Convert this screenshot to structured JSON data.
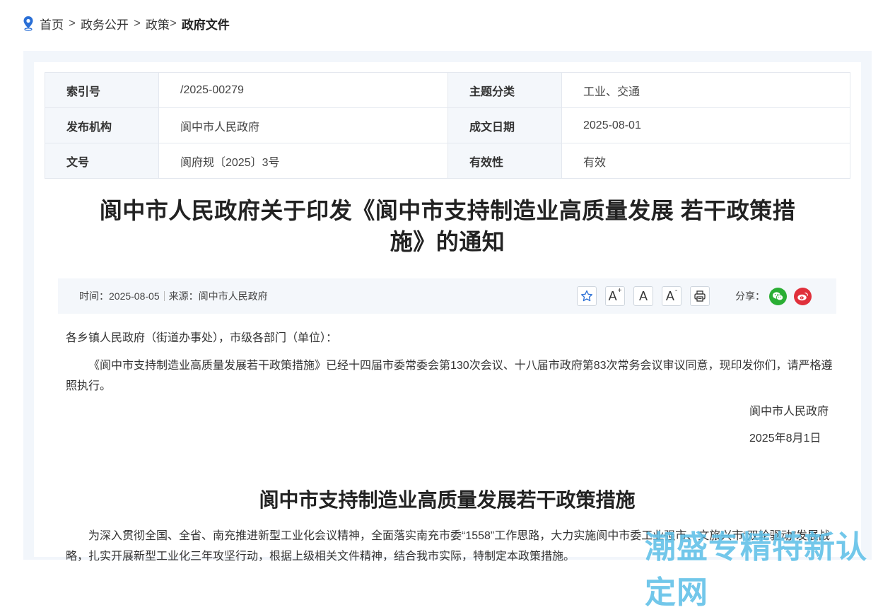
{
  "breadcrumb": {
    "home": "首页",
    "sep": ">",
    "item1": "政务公开",
    "item2": "政策",
    "item2_sep": ">",
    "current": "政府文件"
  },
  "info": {
    "index_label": "索引号",
    "index_value": "/2025-00279",
    "topic_label": "主题分类",
    "topic_value": "工业、交通",
    "issuer_label": "发布机构",
    "issuer_value": "阆中市人民政府",
    "date_label": "成文日期",
    "date_value": "2025-08-01",
    "docno_label": "文号",
    "docno_value": "阆府规〔2025〕3号",
    "validity_label": "有效性",
    "validity_value": "有效"
  },
  "title_line1": "阆中市人民政府关于印发《阆中市支持制造业高质量发展 若干政策措",
  "title_line2": "施》的通知",
  "meta": {
    "time": "时间：2025-08-05",
    "source": "来源：阆中市人民政府",
    "font_large": "A",
    "font_large_sup": "+",
    "font_normal": "A",
    "font_small": "A",
    "font_small_sup": "-",
    "share_label": "分享："
  },
  "body": {
    "greeting": "各乡镇人民政府（街道办事处），市级各部门（单位）：",
    "paragraph": "《阆中市支持制造业高质量发展若干政策措施》已经十四届市委常委会第130次会议、十八届市政府第83次常务会议审议同意，现印发你们，请严格遵照执行。",
    "signer": "阆中市人民政府",
    "sign_date": "2025年8月1日",
    "heading": "阆中市支持制造业高质量发展若干政策措施",
    "paragraph2": "为深入贯彻全国、全省、南充推进新型工业化会议精神，全面落实南充市委“1558”工作思路，大力实施阆中市委工业强市、文旅兴市“双轮驱动”发展战略，扎实开展新型工业化三年攻坚行动，根据上级相关文件精神，结合我市实际，特制定本政策措施。"
  },
  "watermark": "潮盛专精特新认定网",
  "colors": {
    "accent": "#2a6fd6",
    "wechat": "#2aae34",
    "weibo": "#e0303b",
    "panel": "#f2f6fb"
  }
}
